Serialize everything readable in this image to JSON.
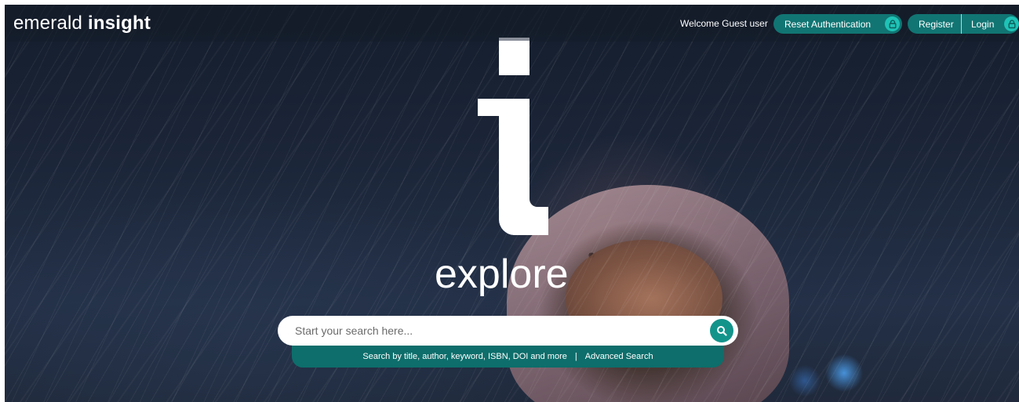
{
  "header": {
    "logo_light": "emerald",
    "logo_bold": "insight",
    "welcome_text": "Welcome Guest user",
    "reset_auth_label": "Reset Authentication",
    "register_label": "Register",
    "login_label": "Login"
  },
  "hero": {
    "tagline": "explore",
    "background": "snow-night-child-photo"
  },
  "search": {
    "placeholder": "Start your search here...",
    "value": "",
    "hint_text": "Search by title, author, keyword, ISBN, DOI and more",
    "separator": "|",
    "advanced_label": "Advanced Search",
    "icon": "search-icon"
  },
  "colors": {
    "accent": "#117573",
    "accent_bright": "#1ec3b6",
    "search_button": "#13948b",
    "hint_bar": "#0d6e6b"
  }
}
